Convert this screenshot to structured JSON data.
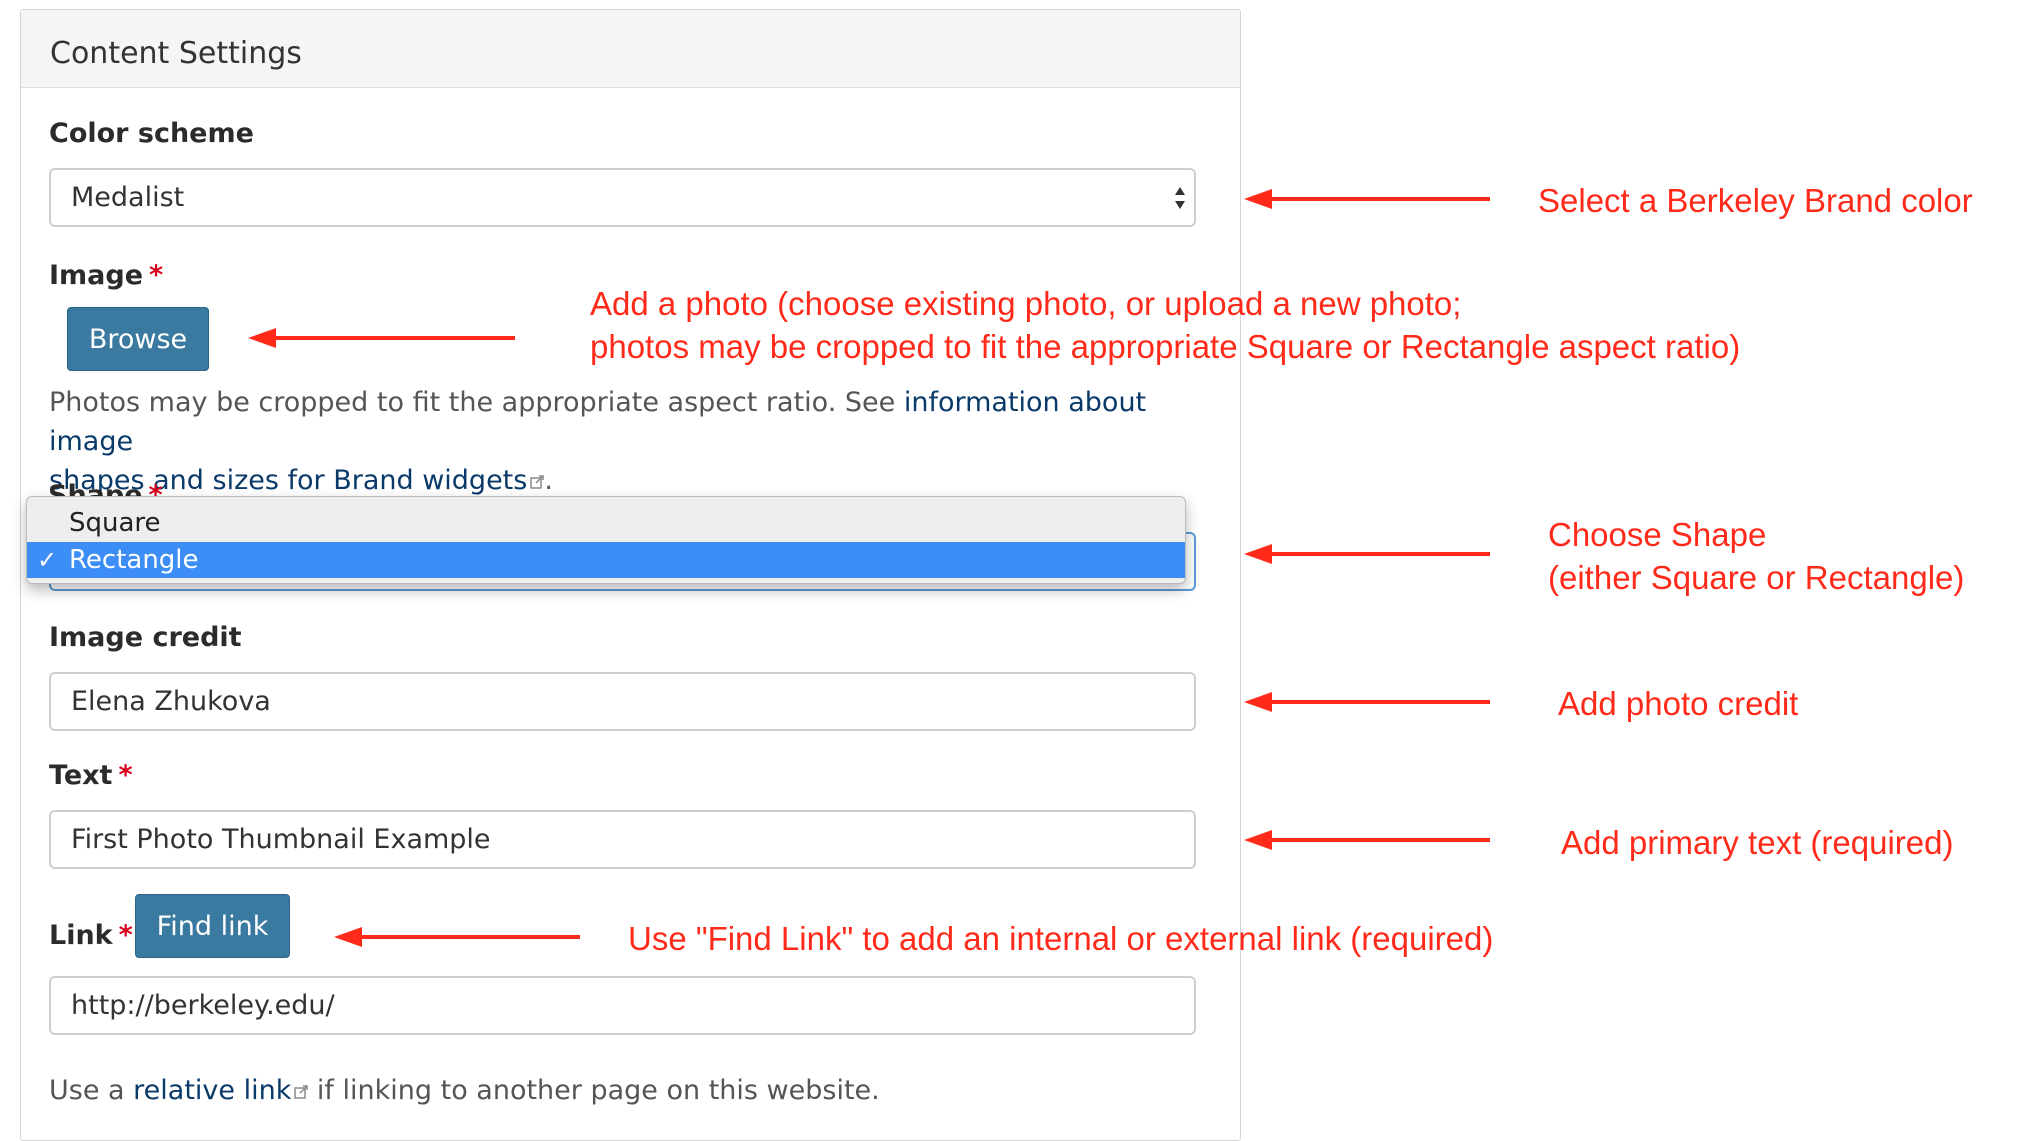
{
  "panel": {
    "title": "Content Settings"
  },
  "color_scheme": {
    "label": "Color scheme",
    "value": "Medalist"
  },
  "image": {
    "label": "Image",
    "required_mark": "*",
    "browse_label": "Browse",
    "help_prefix": "Photos may be cropped to fit the appropriate aspect ratio. See ",
    "help_link": "information about image",
    "help_link2": "shapes and sizes for Brand widgets",
    "help_suffix": "."
  },
  "shape": {
    "label": "Shape",
    "required_mark": "*",
    "options": [
      "Square",
      "Rectangle"
    ],
    "selected": "Rectangle",
    "check_glyph": "✓"
  },
  "image_credit": {
    "label": "Image credit",
    "value": "Elena Zhukova"
  },
  "text_field": {
    "label": "Text",
    "required_mark": "*",
    "value": "First Photo Thumbnail Example"
  },
  "link_field": {
    "label": "Link",
    "required_mark": "*",
    "find_label": "Find link",
    "value": "http://berkeley.edu/",
    "help_prefix": "Use a ",
    "help_link": "relative link",
    "help_suffix": " if linking to another page on this website."
  },
  "annotations": {
    "color": "Select a Berkeley Brand color",
    "image_line1": "Add a photo (choose existing photo, or upload a new photo;",
    "image_line2": "photos may be cropped to fit the appropriate Square or Rectangle aspect ratio)",
    "shape_line1": "Choose Shape",
    "shape_line2": "(either Square or Rectangle)",
    "credit": "Add photo credit",
    "text": "Add primary text (required)",
    "link": "Use \"Find Link\" to add an internal or external link (required)"
  },
  "colors": {
    "annotation_red": "#ff2a1a",
    "button_blue": "#3a79a0",
    "selected_blue": "#3c8df5",
    "required_red": "#d6001c"
  }
}
